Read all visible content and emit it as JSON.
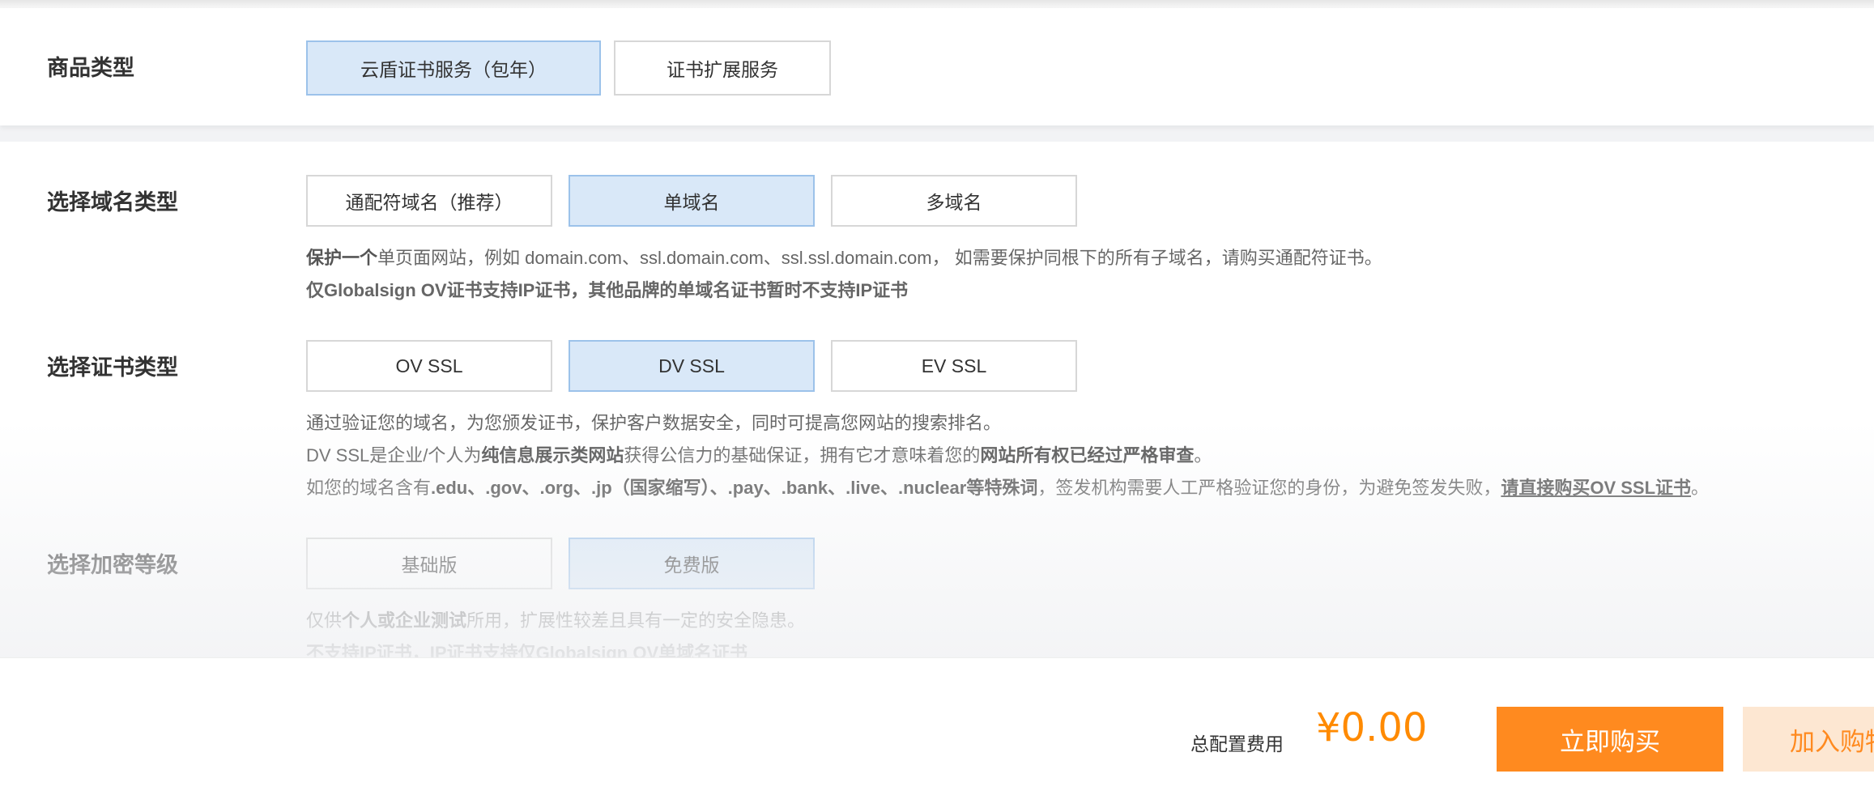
{
  "product_type": {
    "label": "商品类型",
    "options": [
      "云盾证书服务（包年）",
      "证书扩展服务"
    ],
    "selected_index": 0
  },
  "domain_type": {
    "label": "选择域名类型",
    "options": [
      "通配符域名（推荐）",
      "单域名",
      "多域名"
    ],
    "selected_index": 1,
    "desc_line1_bold": "保护一个",
    "desc_line1_rest": "单页面网站，例如 domain.com、ssl.domain.com、ssl.ssl.domain.com， 如需要保护同根下的所有子域名，请购买通配符证书。",
    "desc_line2": "仅Globalsign OV证书支持IP证书，其他品牌的单域名证书暂时不支持IP证书"
  },
  "cert_type": {
    "label": "选择证书类型",
    "options": [
      "OV SSL",
      "DV SSL",
      "EV SSL"
    ],
    "selected_index": 1,
    "desc_line1": "通过验证您的域名，为您颁发证书，保护客户数据安全，同时可提高您网站的搜索排名。",
    "desc_line2_a": "DV SSL是企业/个人为",
    "desc_line2_b": "纯信息展示类网站",
    "desc_line2_c": "获得公信力的基础保证，拥有它才意味着您的",
    "desc_line2_d": "网站所有权已经过严格审查",
    "desc_line2_e": "。",
    "desc_line3_a": "如您的域名含有",
    "desc_line3_b": ".edu、.gov、.org、.jp（国家缩写）、.pay、.bank、.live、.nuclear等特殊词",
    "desc_line3_c": "，签发机构需要人工严格验证您的身份，为避免签发失败，",
    "desc_line3_link": "请直接购买OV SSL证书",
    "desc_line3_d": "。"
  },
  "encryption": {
    "label": "选择加密等级",
    "options": [
      "基础版",
      "免费版"
    ],
    "selected_index": 1,
    "desc_line1_a": "仅供",
    "desc_line1_b": "个人或企业测试",
    "desc_line1_c": "所用，扩展性较差且具有一定的安全隐患。",
    "desc_line2": "不支持IP证书，IP证书支持仅Globalsign OV单域名证书"
  },
  "footer": {
    "total_label": "总配置费用",
    "price": "¥0.00",
    "buy_label": "立即购买",
    "cart_label": "加入购物车"
  },
  "colors": {
    "accent": "#ff8a1f",
    "selected_bg": "#d9e8f8",
    "selected_border": "#9cc2ea"
  }
}
